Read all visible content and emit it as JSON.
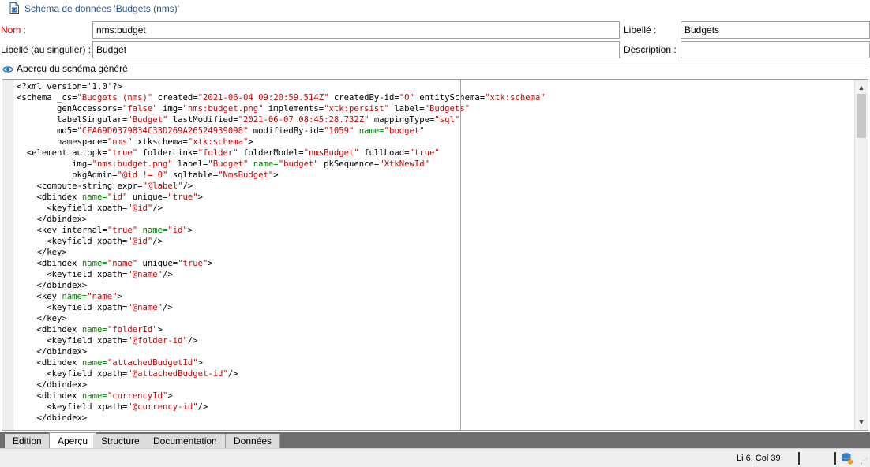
{
  "window": {
    "title": "Schéma de données 'Budgets (nms)'"
  },
  "form": {
    "name_label": "Nom :",
    "name_value": "nms:budget",
    "label_label": "Libellé :",
    "label_value": "Budgets",
    "singular_label": "Libellé (au singulier) :",
    "singular_value": "Budget",
    "description_label": "Description :",
    "description_value": ""
  },
  "preview": {
    "section_title": "Aperçu du schéma généré"
  },
  "code_lines": [
    [
      {
        "t": "<?xml version=",
        "c": "tag"
      },
      {
        "t": "'1.0'",
        "c": "tag"
      },
      {
        "t": "?>",
        "c": "tag"
      }
    ],
    [
      {
        "t": "<schema _cs=",
        "c": "tag"
      },
      {
        "t": "\"Budgets (nms)\"",
        "c": "val"
      },
      {
        "t": " created=",
        "c": "tag"
      },
      {
        "t": "\"2021-06-04 09:20:59.514Z\"",
        "c": "val"
      },
      {
        "t": " createdBy-id=",
        "c": "tag"
      },
      {
        "t": "\"0\"",
        "c": "val"
      },
      {
        "t": " entitySchema=",
        "c": "tag"
      },
      {
        "t": "\"xtk:schema\"",
        "c": "val"
      }
    ],
    [
      {
        "t": "        genAccessors=",
        "c": "tag"
      },
      {
        "t": "\"false\"",
        "c": "val"
      },
      {
        "t": " img=",
        "c": "tag"
      },
      {
        "t": "\"nms:budget.png\"",
        "c": "val"
      },
      {
        "t": " implements=",
        "c": "tag"
      },
      {
        "t": "\"xtk:persist\"",
        "c": "val"
      },
      {
        "t": " label=",
        "c": "tag"
      },
      {
        "t": "\"Budgets\"",
        "c": "val"
      }
    ],
    [
      {
        "t": "        labelSingular=",
        "c": "tag"
      },
      {
        "t": "\"Budget\"",
        "c": "val"
      },
      {
        "t": " lastModified=",
        "c": "tag"
      },
      {
        "t": "\"2021-06-07 08:45:28.732Z\"",
        "c": "val"
      },
      {
        "t": " mappingType=",
        "c": "tag"
      },
      {
        "t": "\"sql\"",
        "c": "val"
      }
    ],
    [
      {
        "t": "        md5=",
        "c": "tag"
      },
      {
        "t": "\"CFA69D0379834C33D269A26524939098\"",
        "c": "val"
      },
      {
        "t": " modifiedBy-id=",
        "c": "tag"
      },
      {
        "t": "\"1059\"",
        "c": "val"
      },
      {
        "t": " name=",
        "c": "nm"
      },
      {
        "t": "\"budget\"",
        "c": "val"
      }
    ],
    [
      {
        "t": "        namespace=",
        "c": "tag"
      },
      {
        "t": "\"nms\"",
        "c": "val"
      },
      {
        "t": " xtkschema=",
        "c": "tag"
      },
      {
        "t": "\"xtk:schema\"",
        "c": "val"
      },
      {
        "t": ">",
        "c": "tag"
      }
    ],
    [
      {
        "t": "  <element autopk=",
        "c": "tag"
      },
      {
        "t": "\"true\"",
        "c": "val"
      },
      {
        "t": " folderLink=",
        "c": "tag"
      },
      {
        "t": "\"folder\"",
        "c": "val"
      },
      {
        "t": " folderModel=",
        "c": "tag"
      },
      {
        "t": "\"nmsBudget\"",
        "c": "val"
      },
      {
        "t": " fullLoad=",
        "c": "tag"
      },
      {
        "t": "\"true\"",
        "c": "val"
      }
    ],
    [
      {
        "t": "           img=",
        "c": "tag"
      },
      {
        "t": "\"nms:budget.png\"",
        "c": "val"
      },
      {
        "t": " label=",
        "c": "tag"
      },
      {
        "t": "\"Budget\"",
        "c": "val"
      },
      {
        "t": " name=",
        "c": "nm"
      },
      {
        "t": "\"budget\"",
        "c": "val"
      },
      {
        "t": " pkSequence=",
        "c": "tag"
      },
      {
        "t": "\"XtkNewId\"",
        "c": "val"
      }
    ],
    [
      {
        "t": "           pkgAdmin=",
        "c": "tag"
      },
      {
        "t": "\"@id != 0\"",
        "c": "val"
      },
      {
        "t": " sqltable=",
        "c": "tag"
      },
      {
        "t": "\"NmsBudget\"",
        "c": "val"
      },
      {
        "t": ">",
        "c": "tag"
      }
    ],
    [
      {
        "t": "    <compute-string expr=",
        "c": "tag"
      },
      {
        "t": "\"@label\"",
        "c": "val"
      },
      {
        "t": "/>",
        "c": "tag"
      }
    ],
    [
      {
        "t": "    <dbindex ",
        "c": "tag"
      },
      {
        "t": "name=",
        "c": "nm"
      },
      {
        "t": "\"id\"",
        "c": "val"
      },
      {
        "t": " unique=",
        "c": "tag"
      },
      {
        "t": "\"true\"",
        "c": "val"
      },
      {
        "t": ">",
        "c": "tag"
      }
    ],
    [
      {
        "t": "      <keyfield xpath=",
        "c": "tag"
      },
      {
        "t": "\"@id\"",
        "c": "val"
      },
      {
        "t": "/>",
        "c": "tag"
      }
    ],
    [
      {
        "t": "    </dbindex>",
        "c": "tag"
      }
    ],
    [
      {
        "t": "    <key internal=",
        "c": "tag"
      },
      {
        "t": "\"true\"",
        "c": "val"
      },
      {
        "t": " name=",
        "c": "nm"
      },
      {
        "t": "\"id\"",
        "c": "val"
      },
      {
        "t": ">",
        "c": "tag"
      }
    ],
    [
      {
        "t": "      <keyfield xpath=",
        "c": "tag"
      },
      {
        "t": "\"@id\"",
        "c": "val"
      },
      {
        "t": "/>",
        "c": "tag"
      }
    ],
    [
      {
        "t": "    </key>",
        "c": "tag"
      }
    ],
    [
      {
        "t": "    <dbindex ",
        "c": "tag"
      },
      {
        "t": "name=",
        "c": "nm"
      },
      {
        "t": "\"name\"",
        "c": "val"
      },
      {
        "t": " unique=",
        "c": "tag"
      },
      {
        "t": "\"true\"",
        "c": "val"
      },
      {
        "t": ">",
        "c": "tag"
      }
    ],
    [
      {
        "t": "      <keyfield xpath=",
        "c": "tag"
      },
      {
        "t": "\"@name\"",
        "c": "val"
      },
      {
        "t": "/>",
        "c": "tag"
      }
    ],
    [
      {
        "t": "    </dbindex>",
        "c": "tag"
      }
    ],
    [
      {
        "t": "    <key ",
        "c": "tag"
      },
      {
        "t": "name=",
        "c": "nm"
      },
      {
        "t": "\"name\"",
        "c": "val"
      },
      {
        "t": ">",
        "c": "tag"
      }
    ],
    [
      {
        "t": "      <keyfield xpath=",
        "c": "tag"
      },
      {
        "t": "\"@name\"",
        "c": "val"
      },
      {
        "t": "/>",
        "c": "tag"
      }
    ],
    [
      {
        "t": "    </key>",
        "c": "tag"
      }
    ],
    [
      {
        "t": "    <dbindex ",
        "c": "tag"
      },
      {
        "t": "name=",
        "c": "nm"
      },
      {
        "t": "\"folderId\"",
        "c": "val"
      },
      {
        "t": ">",
        "c": "tag"
      }
    ],
    [
      {
        "t": "      <keyfield xpath=",
        "c": "tag"
      },
      {
        "t": "\"@folder-id\"",
        "c": "val"
      },
      {
        "t": "/>",
        "c": "tag"
      }
    ],
    [
      {
        "t": "    </dbindex>",
        "c": "tag"
      }
    ],
    [
      {
        "t": "    <dbindex ",
        "c": "tag"
      },
      {
        "t": "name=",
        "c": "nm"
      },
      {
        "t": "\"attachedBudgetId\"",
        "c": "val"
      },
      {
        "t": ">",
        "c": "tag"
      }
    ],
    [
      {
        "t": "      <keyfield xpath=",
        "c": "tag"
      },
      {
        "t": "\"@attachedBudget-id\"",
        "c": "val"
      },
      {
        "t": "/>",
        "c": "tag"
      }
    ],
    [
      {
        "t": "    </dbindex>",
        "c": "tag"
      }
    ],
    [
      {
        "t": "    <dbindex ",
        "c": "tag"
      },
      {
        "t": "name=",
        "c": "nm"
      },
      {
        "t": "\"currencyId\"",
        "c": "val"
      },
      {
        "t": ">",
        "c": "tag"
      }
    ],
    [
      {
        "t": "      <keyfield xpath=",
        "c": "tag"
      },
      {
        "t": "\"@currency-id\"",
        "c": "val"
      },
      {
        "t": "/>",
        "c": "tag"
      }
    ],
    [
      {
        "t": "    </dbindex>",
        "c": "tag"
      }
    ]
  ],
  "tabs": [
    "Edition",
    "Aperçu",
    "Structure",
    "Documentation",
    "Données"
  ],
  "active_tab": "Aperçu",
  "status": {
    "position": "Li 6, Col 39"
  },
  "colors": {
    "title_blue": "#2b5797",
    "required_red": "#d00000",
    "code_value_red": "#d20000",
    "code_name_green": "#008000"
  }
}
